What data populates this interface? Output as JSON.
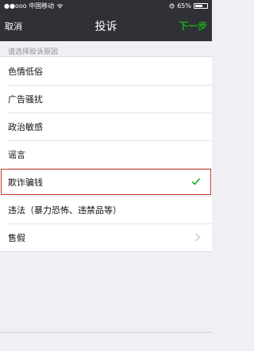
{
  "status": {
    "carrier": "●●ooo 中国移动",
    "time": "",
    "battery": "65%",
    "battery_level": 0.65
  },
  "nav": {
    "cancel": "取消",
    "title": "投诉",
    "next": "下一步"
  },
  "section_label": "请选择投诉原因",
  "reasons": [
    {
      "label": "色情低俗"
    },
    {
      "label": "广告骚扰"
    },
    {
      "label": "政治敏感"
    },
    {
      "label": "谣言"
    },
    {
      "label": "欺诈骗钱",
      "selected": true
    },
    {
      "label": "违法（暴力恐怖、违禁品等）"
    },
    {
      "label": "售假",
      "has_chevron": true
    }
  ],
  "colors": {
    "accent_green": "#1aad19",
    "checkmark": "#1aad19",
    "highlight_box": "#c0392b",
    "navbar_bg": "#2f3136"
  },
  "icons": {
    "wifi": "wifi-icon",
    "alarm": "alarm-icon",
    "battery": "battery-icon",
    "checkmark": "checkmark-icon",
    "chevron": "chevron-right-icon"
  }
}
